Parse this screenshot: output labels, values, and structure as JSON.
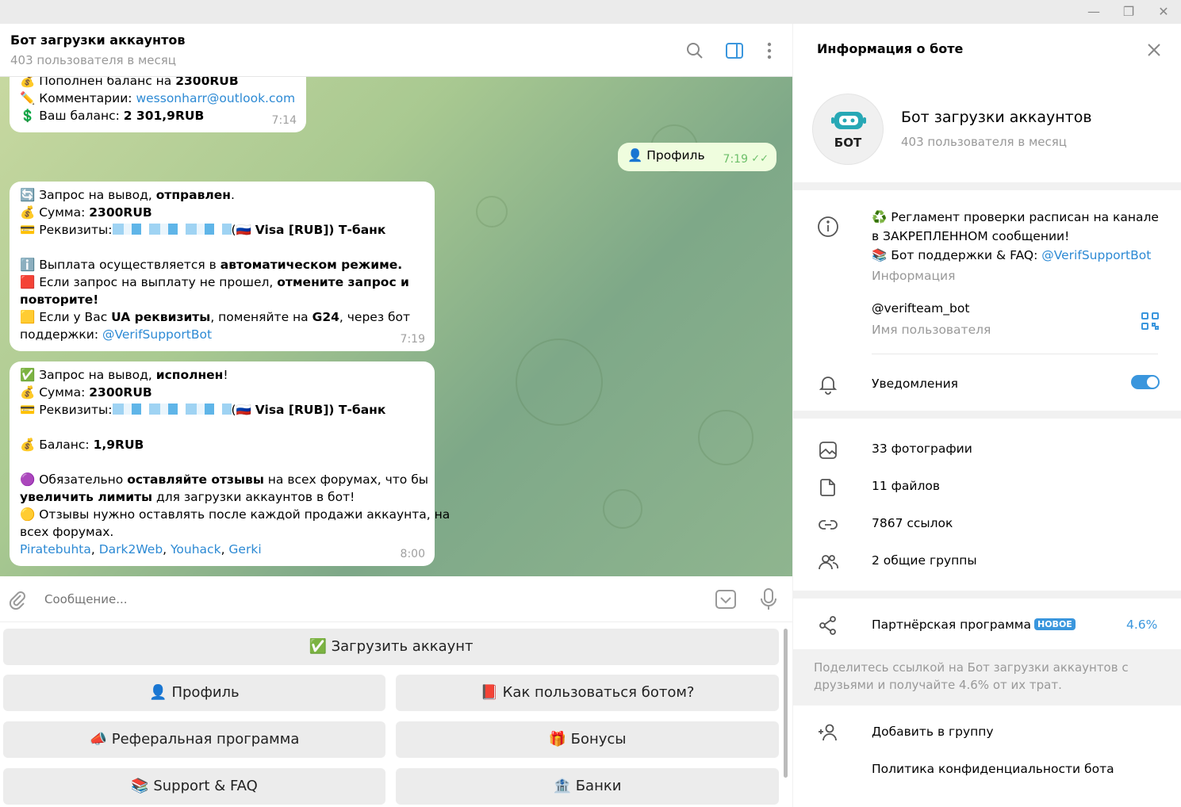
{
  "chat": {
    "title": "Бот загрузки аккаунтов",
    "subtitle": "403 пользователя в месяц",
    "messages": {
      "m1": {
        "l1_text": "Пополнен баланс на ",
        "l1_bold": "2300RUB",
        "l2_text": "Комментарии: ",
        "l2_link": "wessonharr@outlook.com",
        "l3_text": "Ваш баланс: ",
        "l3_bold": "2 301,9RUB",
        "time": "7:14"
      },
      "m2": {
        "text": "Профиль",
        "time": "7:19"
      },
      "m3": {
        "l1_text": "Запрос на вывод, ",
        "l1_bold": "отправлен",
        "l1_end": ".",
        "l2_text": "Сумма: ",
        "l2_bold": "2300RUB",
        "l3_text": "Реквизиты:",
        "l3_open": "(",
        "l3_bold": "Visa [RUB]) Т-банк",
        "l4_text": "Выплата осуществляется в ",
        "l4_bold": "автоматическом режиме.",
        "l5_text": "Если запрос на выплату не прошел, ",
        "l5_bold": "отмените запрос и",
        "l6_bold": "повторите!",
        "l7_a": "Если у Вас ",
        "l7_b": "UA реквизиты",
        "l7_c": ", поменяйте на ",
        "l7_d": "G24",
        "l7_e": ", через бот",
        "l8_text": "поддержки: ",
        "l8_link": "@VerifSupportBot",
        "time": "7:19"
      },
      "m4": {
        "l1_text": "Запрос на вывод, ",
        "l1_bold": "исполнен",
        "l1_end": "!",
        "l2_text": "Сумма: ",
        "l2_bold": "2300RUB",
        "l3_text": "Реквизиты:",
        "l3_open": "(",
        "l3_bold": "Visa [RUB]) Т-банк",
        "l4_text": "Баланс: ",
        "l4_bold": "1,9RUB",
        "l5_a": "Обязательно ",
        "l5_b": "оставляйте отзывы",
        "l5_c": " на всех форумах, что бы",
        "l6_a": "увеличить лимиты",
        "l6_b": " для загрузки аккаунтов в бот!",
        "l7_text": "Отзывы нужно оставлять после каждой продажи аккаунта, на",
        "l8_text": "всех форумах.",
        "links": [
          "Piratebuhta",
          "Dark2Web",
          "Youhack",
          "Gerki"
        ],
        "sep": ", ",
        "time": "8:00"
      }
    },
    "composer": {
      "placeholder": "Сообщение..."
    },
    "keyboard": {
      "upload": "Загрузить аккаунт",
      "profile": "Профиль",
      "how_to": "Как пользоваться ботом?",
      "referral": "Реферальная программа",
      "bonuses": "Бонусы",
      "support": "Support & FAQ",
      "banks": "Банки"
    }
  },
  "info": {
    "title": "Информация о боте",
    "bot_name": "Бот загрузки аккаунтов",
    "bot_sub": "403 пользователя в месяц",
    "avatar_text": "БОТ",
    "desc_l1": "Регламент проверки расписан на канале",
    "desc_l2": "в ЗАКРЕПЛЕННОМ сообщении!",
    "desc_l3": "Бот поддержки & FAQ: ",
    "desc_link": "@VerifSupportBot",
    "desc_label": "Информация",
    "username": "@verifteam_bot",
    "username_label": "Имя пользователя",
    "notifications": "Уведомления",
    "notifications_on": true,
    "photos": "33 фотографии",
    "files": "11 файлов",
    "links": "7867 ссылок",
    "groups": "2 общие группы",
    "partner": "Партнёрская программа",
    "partner_badge": "НОВОЕ",
    "partner_value": "4.6%",
    "partner_note_l1": "Поделитесь ссылкой на Бот загрузки аккаунтов с",
    "partner_note_l2": "друзьями и получайте 4.6% от их трат.",
    "add_group": "Добавить в группу",
    "privacy": "Политика конфиденциальности бота"
  },
  "colors": {
    "accent": "#3a96dd",
    "link": "#2d8ad4",
    "outgoing": "#effdde"
  }
}
